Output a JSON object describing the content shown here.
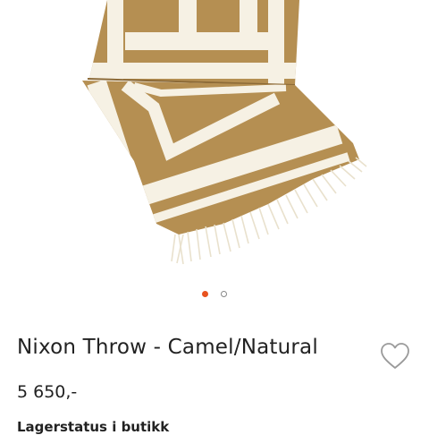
{
  "product": {
    "title": "Nixon Throw - Camel/Natural",
    "price": "5 650,-",
    "stock_heading": "Lagerstatus i butikk"
  },
  "gallery": {
    "image_count": 2,
    "active_index": 0
  },
  "colors": {
    "accent": "#e8531f",
    "camel": "#b58f52",
    "natural": "#f6f1e4",
    "text": "#222222"
  },
  "icons": {
    "favorite": "heart-outline-icon"
  }
}
